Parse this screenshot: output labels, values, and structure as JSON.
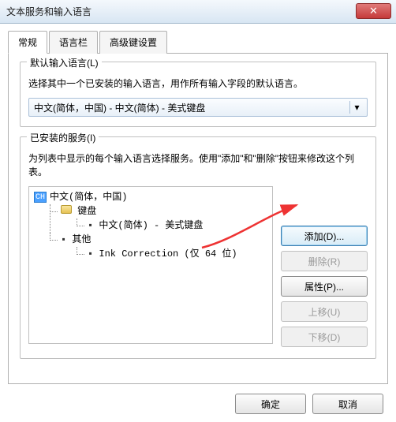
{
  "window": {
    "title": "文本服务和输入语言"
  },
  "tabs": {
    "general": "常规",
    "langbar": "语言栏",
    "advanced": "高级键设置"
  },
  "defaultLang": {
    "groupTitle": "默认输入语言(L)",
    "desc": "选择其中一个已安装的输入语言，用作所有输入字段的默认语言。",
    "selected": "中文(简体，中国) - 中文(简体) - 美式键盘"
  },
  "services": {
    "groupTitle": "已安装的服务(I)",
    "desc": "为列表中显示的每个输入语言选择服务。使用\"添加\"和\"删除\"按钮来修改这个列表。",
    "rootBadge": "CH",
    "rootLabel": "中文(简体，中国)",
    "kbGroup": "键盘",
    "kbItem": "中文(简体) - 美式键盘",
    "otherGroup": "其他",
    "otherItem": "Ink Correction (仅 64 位)"
  },
  "buttons": {
    "add": "添加(D)...",
    "remove": "删除(R)",
    "props": "属性(P)...",
    "up": "上移(U)",
    "down": "下移(D)"
  },
  "footer": {
    "ok": "确定",
    "cancel": "取消"
  }
}
